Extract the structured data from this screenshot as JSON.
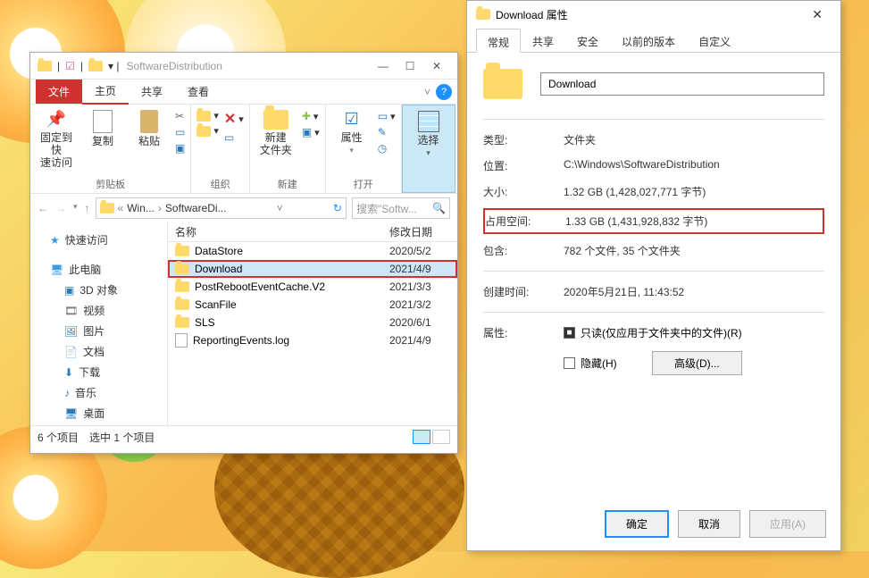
{
  "explorer": {
    "title": "SoftwareDistribution",
    "tabs": {
      "file": "文件",
      "home": "主页",
      "share": "共享",
      "view": "查看"
    },
    "ribbon": {
      "pin": "固定到快\n速访问",
      "copy": "复制",
      "paste": "粘贴",
      "clipboard": "剪贴板",
      "organize": "组织",
      "new": "新建",
      "newfolder": "新建\n文件夹",
      "open": "打开",
      "properties": "属性",
      "select": "选择"
    },
    "breadcrumb": {
      "a": "Win...",
      "b": "SoftwareDi..."
    },
    "search_placeholder": "搜索\"Softw...",
    "nav": {
      "quick": "快速访问",
      "pc": "此电脑",
      "objects3d": "3D 对象",
      "videos": "视频",
      "pictures": "图片",
      "documents": "文档",
      "downloads": "下载",
      "music": "音乐",
      "desktop": "桌面"
    },
    "columns": {
      "name": "名称",
      "date": "修改日期"
    },
    "files": [
      {
        "name": "DataStore",
        "type": "folder",
        "date": "2020/5/2"
      },
      {
        "name": "Download",
        "type": "folder",
        "date": "2021/4/9",
        "selected": true
      },
      {
        "name": "PostRebootEventCache.V2",
        "type": "folder",
        "date": "2021/3/3"
      },
      {
        "name": "ScanFile",
        "type": "folder",
        "date": "2021/3/2"
      },
      {
        "name": "SLS",
        "type": "folder",
        "date": "2020/6/1"
      },
      {
        "name": "ReportingEvents.log",
        "type": "file",
        "date": "2021/4/9"
      }
    ],
    "status": {
      "count": "6 个项目",
      "sel": "选中 1 个项目"
    }
  },
  "props": {
    "title": "Download 属性",
    "tabs": {
      "general": "常规",
      "share": "共享",
      "security": "安全",
      "prev": "以前的版本",
      "custom": "自定义"
    },
    "name": "Download",
    "rows": {
      "type_l": "类型:",
      "type_v": "文件夹",
      "loc_l": "位置:",
      "loc_v": "C:\\Windows\\SoftwareDistribution",
      "size_l": "大小:",
      "size_v": "1.32 GB (1,428,027,771 字节)",
      "disk_l": "占用空间:",
      "disk_v": "1.33 GB (1,431,928,832 字节)",
      "contains_l": "包含:",
      "contains_v": "782 个文件, 35 个文件夹",
      "created_l": "创建时间:",
      "created_v": "2020年5月21日, 11:43:52",
      "attr_l": "属性:",
      "readonly": "只读(仅应用于文件夹中的文件)(R)",
      "hidden": "隐藏(H)",
      "advanced": "高级(D)..."
    },
    "buttons": {
      "ok": "确定",
      "cancel": "取消",
      "apply": "应用(A)"
    }
  }
}
